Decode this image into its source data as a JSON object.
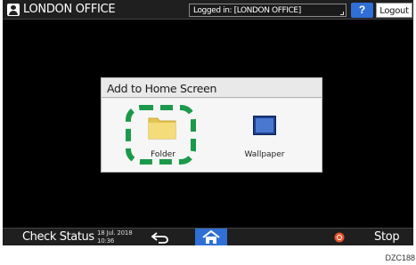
{
  "topbar": {
    "office_title": "LONDON OFFICE",
    "login_text": "Logged in: [LONDON OFFICE]",
    "help_label": "?",
    "logout_label": "Logout"
  },
  "dialog": {
    "title": "Add to Home Screen",
    "items": [
      {
        "label": "Folder",
        "icon": "folder-icon",
        "highlighted": true
      },
      {
        "label": "Wallpaper",
        "icon": "wallpaper-icon",
        "highlighted": false
      }
    ]
  },
  "bottombar": {
    "check_status_label": "Check Status",
    "date": "18 Jul. 2018",
    "time": "10:36",
    "stop_label": "Stop"
  },
  "figure_code": "DZC188",
  "colors": {
    "screen_bg": "#000000",
    "accent_blue": "#2f6fd6",
    "highlight_green": "#1a9a4a",
    "folder_yellow": "#f2d66b",
    "stop_orange": "#e8542a"
  }
}
